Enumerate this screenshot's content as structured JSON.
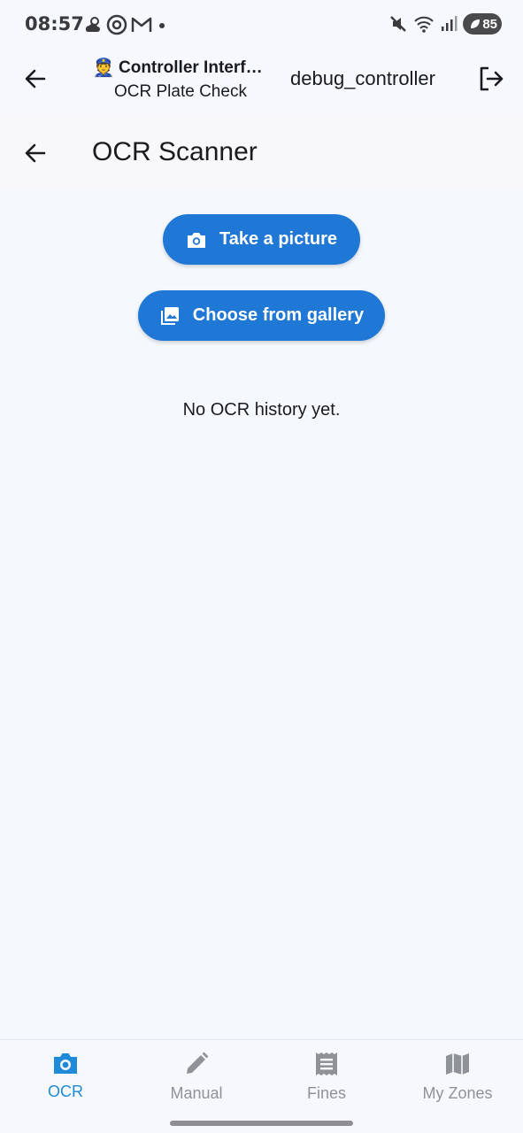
{
  "status_bar": {
    "time": "08:57",
    "battery": "85",
    "left_icons": [
      "weather-icon",
      "settings-badge-icon",
      "gmail-icon",
      "dot-icon"
    ],
    "right_icons": [
      "mute-icon",
      "wifi-icon",
      "signal-icon",
      "battery-icon"
    ]
  },
  "top_bar": {
    "emoji": "👮",
    "title": "Controller Interfa…",
    "subtitle": "OCR Plate Check",
    "username": "debug_controller"
  },
  "sub_bar": {
    "title": "OCR Scanner"
  },
  "content": {
    "take_picture_label": "Take a picture",
    "gallery_label": "Choose from gallery",
    "empty_message": "No OCR history yet."
  },
  "bottom_nav": {
    "items": [
      {
        "label": "OCR",
        "icon": "camera-icon",
        "active": true
      },
      {
        "label": "Manual",
        "icon": "pencil-icon",
        "active": false
      },
      {
        "label": "Fines",
        "icon": "receipt-icon",
        "active": false
      },
      {
        "label": "My Zones",
        "icon": "map-icon",
        "active": false
      }
    ]
  },
  "colors": {
    "primary": "#1f77d6",
    "nav_active": "#1f8ad8",
    "nav_inactive": "#8f9296",
    "background": "#f5f9fe"
  }
}
